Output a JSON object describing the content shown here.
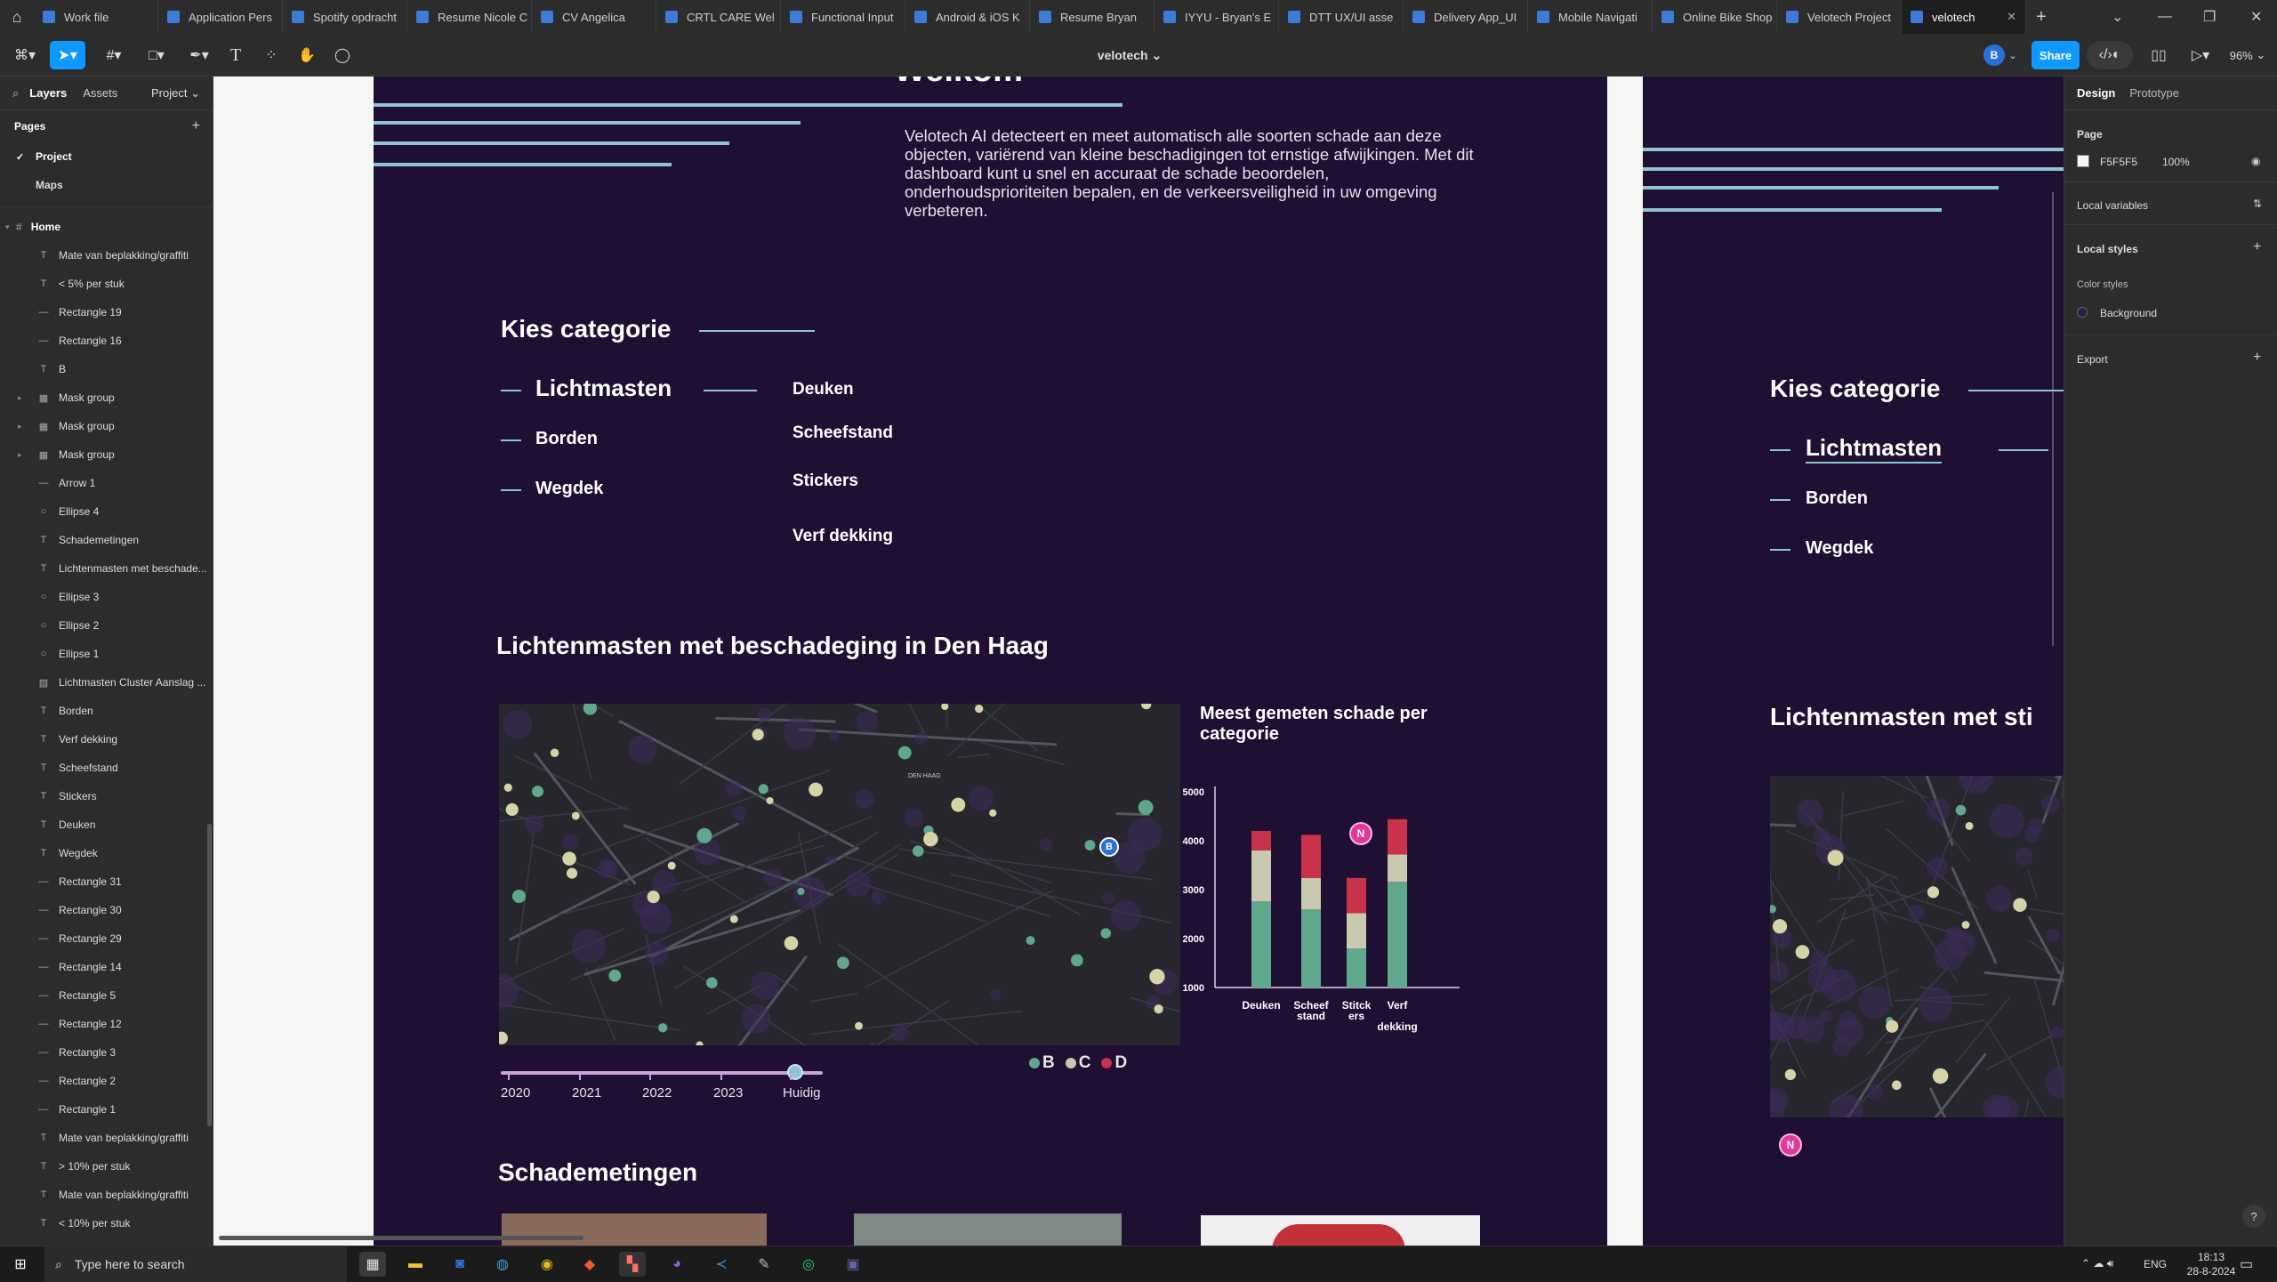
{
  "tabs": [
    "Work file",
    "Application Pers",
    "Spotify opdracht",
    "Resume Nicole C",
    "CV Angelica",
    "CRTL CARE Wel",
    "Functional Input",
    "Android & iOS K",
    "Resume Bryan",
    "IYYU - Bryan's E",
    "DTT UX/UI asse",
    "Delivery App_UI",
    "Mobile Navigati",
    "Online Bike Shop",
    "Velotech Project",
    "velotech"
  ],
  "toolbar": {
    "file_name": "velotech",
    "avatar": "B",
    "share": "Share",
    "zoom": "96%"
  },
  "left_panel": {
    "tab_layers": "Layers",
    "tab_assets": "Assets",
    "project_menu": "Project",
    "pages_title": "Pages",
    "pages": [
      "Project",
      "Maps"
    ],
    "home": "Home",
    "layers": [
      {
        "name": "Mate van beplakking/graffiti",
        "t": "T"
      },
      {
        "name": "< 5% per stuk",
        "t": "T"
      },
      {
        "name": "Rectangle 19",
        "t": "—"
      },
      {
        "name": "Rectangle 16",
        "t": "—"
      },
      {
        "name": "B",
        "t": "T"
      },
      {
        "name": "Mask group",
        "t": "▦",
        "c": true
      },
      {
        "name": "Mask group",
        "t": "▦",
        "c": true
      },
      {
        "name": "Mask group",
        "t": "▦",
        "c": true
      },
      {
        "name": "Arrow 1",
        "t": "—"
      },
      {
        "name": "Ellipse 4",
        "t": "○"
      },
      {
        "name": "Schademetingen",
        "t": "T"
      },
      {
        "name": "Lichtenmasten met beschade...",
        "t": "T"
      },
      {
        "name": "Ellipse 3",
        "t": "○"
      },
      {
        "name": "Ellipse 2",
        "t": "○"
      },
      {
        "name": "Ellipse 1",
        "t": "○"
      },
      {
        "name": "Lichtmasten Cluster Aanslag ...",
        "t": "▨"
      },
      {
        "name": "Borden",
        "t": "T"
      },
      {
        "name": "Verf dekking",
        "t": "T"
      },
      {
        "name": "Scheefstand",
        "t": "T"
      },
      {
        "name": "Stickers",
        "t": "T"
      },
      {
        "name": "Deuken",
        "t": "T"
      },
      {
        "name": "Wegdek",
        "t": "T"
      },
      {
        "name": "Rectangle 31",
        "t": "—"
      },
      {
        "name": "Rectangle 30",
        "t": "—"
      },
      {
        "name": "Rectangle 29",
        "t": "—"
      },
      {
        "name": "Rectangle 14",
        "t": "—"
      },
      {
        "name": "Rectangle 5",
        "t": "—"
      },
      {
        "name": "Rectangle 12",
        "t": "—"
      },
      {
        "name": "Rectangle 3",
        "t": "—"
      },
      {
        "name": "Rectangle 2",
        "t": "—"
      },
      {
        "name": "Rectangle 1",
        "t": "—"
      },
      {
        "name": "Mate van beplakking/graffiti",
        "t": "T"
      },
      {
        "name": "> 10% per stuk",
        "t": "T"
      },
      {
        "name": "Mate van beplakking/graffiti",
        "t": "T"
      },
      {
        "name": "< 10% per stuk",
        "t": "T"
      }
    ]
  },
  "canvas": {
    "welkom": "Welkom",
    "intro": "Velotech AI detecteert en meet automatisch alle soorten schade aan deze objecten, variërend van kleine beschadigingen tot ernstige afwijkingen. Met dit dashboard  kunt u snel en accuraat de schade beoordelen, onderhoudsprioriteiten bepalen, en de verkeersveiligheid in uw omgeving verbeteren.",
    "kies": "Kies categorie",
    "cats_left": [
      "Lichtmasten",
      "Borden",
      "Wegdek"
    ],
    "cats_right": [
      "Deuken",
      "Scheefstand",
      "Stickers",
      "Verf dekking"
    ],
    "map_title": "Lichtenmasten met beschadeging in Den Haag",
    "map_label": "DEN HAAG",
    "chart_title": "Meest gemeten schade per categorie",
    "years": [
      "2020",
      "2021",
      "2022",
      "2023",
      "Huidig"
    ],
    "slider_value": "Huidig",
    "legend": [
      "B",
      "C",
      "D"
    ],
    "legend_colors": [
      "#5fa88c",
      "#c8c9b0",
      "#c8324a"
    ],
    "schade": "Schademetingen",
    "cursor_b": "B",
    "cursor_n": "N",
    "frameB": {
      "kies": "Kies categorie",
      "cats": [
        "Lichtmasten",
        "Borden",
        "Wegdek"
      ],
      "map_title": "Lichtenmasten met sti",
      "cursor": "N"
    }
  },
  "chart_data": {
    "type": "bar",
    "title": "Meest gemeten schade per categorie",
    "categories": [
      "Deuken",
      "Scheef stand",
      "Stitck ers",
      "Verf dekking"
    ],
    "category_labels": [
      [
        "Deuken"
      ],
      [
        "Scheef",
        "stand"
      ],
      [
        "Stitck",
        "ers"
      ],
      [
        "Verf",
        "",
        "dekking"
      ]
    ],
    "series": [
      {
        "name": "B",
        "color": "#5fa88c",
        "values": [
          2200,
          2000,
          1000,
          2700
        ]
      },
      {
        "name": "C",
        "color": "#c8c9b0",
        "values": [
          1300,
          800,
          900,
          700
        ]
      },
      {
        "name": "D",
        "color": "#c8324a",
        "values": [
          500,
          1100,
          900,
          900
        ]
      }
    ],
    "yticks": [
      1000,
      2000,
      3000,
      4000,
      5000
    ],
    "ylim": [
      1000,
      5000
    ]
  },
  "right_panel": {
    "tab_design": "Design",
    "tab_prototype": "Prototype",
    "page": "Page",
    "page_color": "F5F5F5",
    "page_opacity": "100%",
    "local_variables": "Local variables",
    "local_styles": "Local styles",
    "color_styles": "Color styles",
    "background": "Background",
    "export": "Export",
    "help": "?"
  },
  "taskbar": {
    "search": "Type here to search",
    "lang": "ENG",
    "time": "18:13",
    "date": "28-8-2024"
  }
}
